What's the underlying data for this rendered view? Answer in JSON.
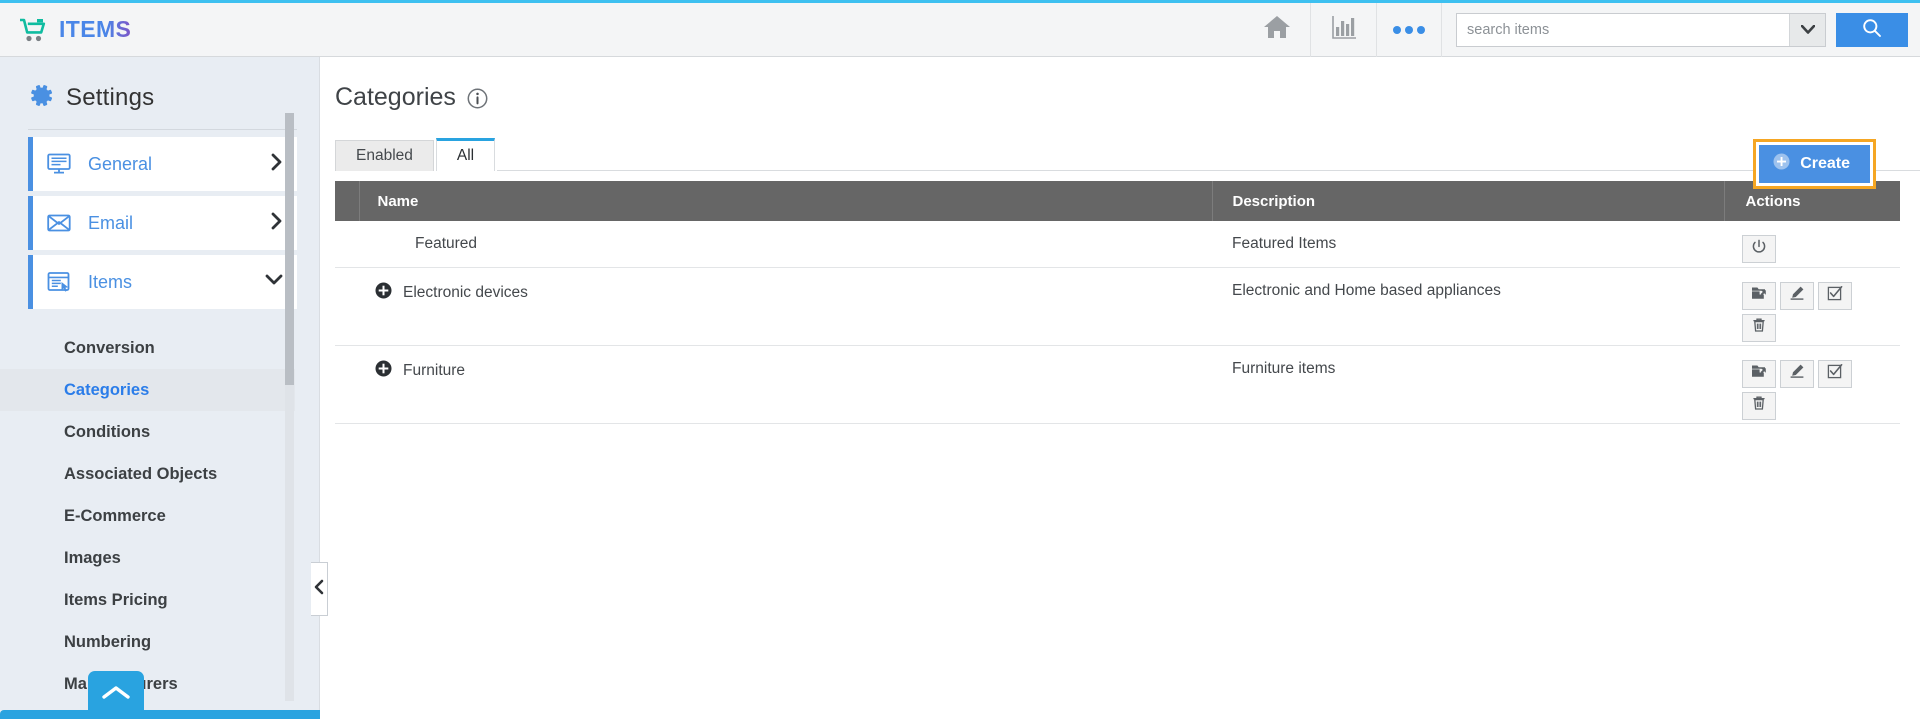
{
  "header": {
    "brand_title": "ITEMS",
    "cart_icon": "shopping-cart-icon",
    "home_icon": "home-icon",
    "chart_icon": "bar-chart-icon",
    "more_icon": "more-dots-icon",
    "search_placeholder": "search items",
    "search_value": "",
    "search_caret_icon": "chevron-down-icon",
    "search_button_icon": "search-icon"
  },
  "sidebar": {
    "title": "Settings",
    "gear_icon": "gear-icon",
    "nav": [
      {
        "label": "General",
        "icon": "monitor-icon",
        "chevron": "chevron-right-icon",
        "expanded": false
      },
      {
        "label": "Email",
        "icon": "envelope-icon",
        "chevron": "chevron-right-icon",
        "expanded": false
      },
      {
        "label": "Items",
        "icon": "window-cursor-icon",
        "chevron": "chevron-down-icon",
        "expanded": true
      }
    ],
    "sub_items": [
      {
        "label": "Conversion",
        "active": false
      },
      {
        "label": "Categories",
        "active": true
      },
      {
        "label": "Conditions",
        "active": false
      },
      {
        "label": "Associated Objects",
        "active": false
      },
      {
        "label": "E-Commerce",
        "active": false
      },
      {
        "label": "Images",
        "active": false
      },
      {
        "label": "Items Pricing",
        "active": false
      },
      {
        "label": "Numbering",
        "active": false
      },
      {
        "label": "Manufacturers",
        "active": false
      }
    ],
    "scroll_to_top_icon": "chevron-up-icon",
    "collapse_icon": "chevron-left-icon"
  },
  "main": {
    "page_title": "Categories",
    "info_icon": "info-icon",
    "create_label": "Create",
    "create_icon": "plus-circle-icon",
    "tabs": [
      {
        "label": "Enabled",
        "active": false
      },
      {
        "label": "All",
        "active": true
      }
    ],
    "table": {
      "columns": [
        "Name",
        "Description",
        "Actions"
      ],
      "rows": [
        {
          "name": "Featured",
          "description": "Featured Items",
          "expandable": false,
          "actions": [
            "power-icon"
          ]
        },
        {
          "name": "Electronic devices",
          "description": "Electronic and Home based appliances",
          "expandable": true,
          "expand_icon": "plus-circle-icon",
          "actions": [
            "move-folder-icon",
            "edit-pencil-icon",
            "checkbox-check-icon",
            "trash-icon"
          ]
        },
        {
          "name": "Furniture",
          "description": "Furniture items",
          "expandable": true,
          "expand_icon": "plus-circle-icon",
          "actions": [
            "move-folder-icon",
            "edit-pencil-icon",
            "checkbox-check-icon",
            "trash-icon"
          ]
        }
      ]
    }
  },
  "colors": {
    "accent_blue": "#4a90e2",
    "brand_green": "#0fbca0",
    "highlight_orange": "#f5a623",
    "tab_active": "#29a3e0",
    "table_header": "#666666",
    "sidebar_bg": "#e8edf3"
  }
}
